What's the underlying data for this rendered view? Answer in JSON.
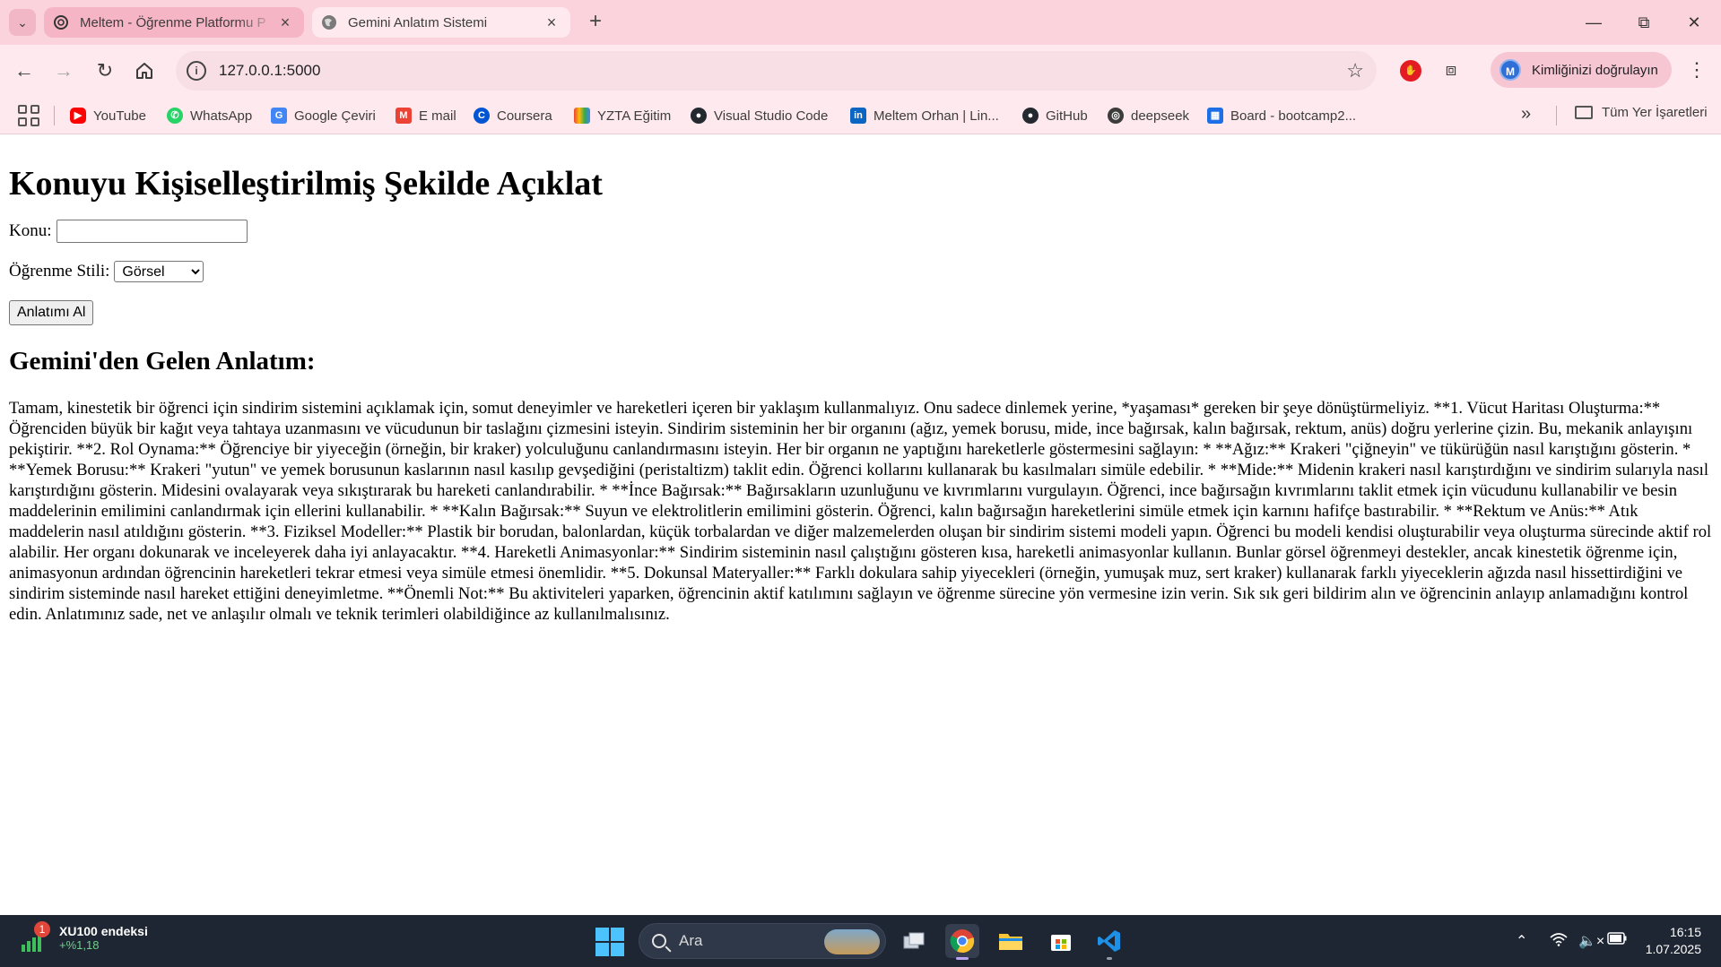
{
  "browser": {
    "tabs": [
      {
        "title": "Meltem - Öğrenme Platformu P",
        "active": false
      },
      {
        "title": "Gemini Anlatım Sistemi",
        "active": true
      }
    ],
    "url": "127.0.0.1:5000",
    "profile_label": "Kimliğinizi doğrulayın",
    "profile_initial": "M",
    "bookmarks": [
      {
        "label": "YouTube",
        "icon": "youtube-icon",
        "color": "#ff0000"
      },
      {
        "label": "WhatsApp",
        "icon": "whatsapp-icon",
        "color": "#25d366"
      },
      {
        "label": "Google Çeviri",
        "icon": "google-translate-icon",
        "color": "#4285f4"
      },
      {
        "label": "E mail",
        "icon": "gmail-icon",
        "color": "#ea4335"
      },
      {
        "label": "Coursera",
        "icon": "coursera-icon",
        "color": "#0056d2"
      },
      {
        "label": "YZTA Eğitim",
        "icon": "yzta-icon",
        "color": "#34a853"
      },
      {
        "label": "Visual Studio Code",
        "icon": "github-icon",
        "color": "#24292f"
      },
      {
        "label": "Meltem Orhan | Lin...",
        "icon": "linkedin-icon",
        "color": "#0a66c2"
      },
      {
        "label": "GitHub",
        "icon": "github-icon",
        "color": "#24292f"
      },
      {
        "label": "deepseek",
        "icon": "globe-icon",
        "color": "#3c3c3c"
      },
      {
        "label": "Board - bootcamp2...",
        "icon": "trello-icon",
        "color": "#1d6fe8"
      }
    ],
    "bookmarks_folder": "Tüm Yer İşaretleri"
  },
  "page": {
    "title": "Konuyu Kişiselleştirilmiş Şekilde Açıklat",
    "topic_label": "Konu:",
    "topic_value": "",
    "style_label": "Öğrenme Stili:",
    "style_selected": "Görsel",
    "submit_label": "Anlatımı Al",
    "result_heading": "Gemini'den Gelen Anlatım:",
    "result_text": "Tamam, kinestetik bir öğrenci için sindirim sistemini açıklamak için, somut deneyimler ve hareketleri içeren bir yaklaşım kullanmalıyız. Onu sadece dinlemek yerine, *yaşaması* gereken bir şeye dönüştürmeliyiz. **1. Vücut Haritası Oluşturma:** Öğrenciden büyük bir kağıt veya tahtaya uzanmasını ve vücudunun bir taslağını çizmesini isteyin. Sindirim sisteminin her bir organını (ağız, yemek borusu, mide, ince bağırsak, kalın bağırsak, rektum, anüs) doğru yerlerine çizin. Bu, mekanik anlayışını pekiştirir. **2. Rol Oynama:** Öğrenciye bir yiyeceğin (örneğin, bir kraker) yolculuğunu canlandırmasını isteyin. Her bir organın ne yaptığını hareketlerle göstermesini sağlayın: * **Ağız:** Krakeri \"çiğneyin\" ve tükürüğün nasıl karıştığını gösterin. * **Yemek Borusu:** Krakeri \"yutun\" ve yemek borusunun kaslarının nasıl kasılıp gevşediğini (peristaltizm) taklit edin. Öğrenci kollarını kullanarak bu kasılmaları simüle edebilir. * **Mide:** Midenin krakeri nasıl karıştırdığını ve sindirim sularıyla nasıl karıştırdığını gösterin. Midesini ovalayarak veya sıkıştırarak bu hareketi canlandırabilir. * **İnce Bağırsak:** Bağırsakların uzunluğunu ve kıvrımlarını vurgulayın. Öğrenci, ince bağırsağın kıvrımlarını taklit etmek için vücudunu kullanabilir ve besin maddelerinin emilimini canlandırmak için ellerini kullanabilir. * **Kalın Bağırsak:** Suyun ve elektrolitlerin emilimini gösterin. Öğrenci, kalın bağırsağın hareketlerini simüle etmek için karnını hafifçe bastırabilir. * **Rektum ve Anüs:** Atık maddelerin nasıl atıldığını gösterin. **3. Fiziksel Modeller:** Plastik bir borudan, balonlardan, küçük torbalardan ve diğer malzemelerden oluşan bir sindirim sistemi modeli yapın. Öğrenci bu modeli kendisi oluşturabilir veya oluşturma sürecinde aktif rol alabilir. Her organı dokunarak ve inceleyerek daha iyi anlayacaktır. **4. Hareketli Animasyonlar:** Sindirim sisteminin nasıl çalıştığını gösteren kısa, hareketli animasyonlar kullanın. Bunlar görsel öğrenmeyi destekler, ancak kinestetik öğrenme için, animasyonun ardından öğrencinin hareketleri tekrar etmesi veya simüle etmesi önemlidir. **5. Dokunsal Materyaller:** Farklı dokulara sahip yiyecekleri (örneğin, yumuşak muz, sert kraker) kullanarak farklı yiyeceklerin ağızda nasıl hissettirdiğini ve sindirim sisteminde nasıl hareket ettiğini deneyimletme. **Önemli Not:** Bu aktiviteleri yaparken, öğrencinin aktif katılımını sağlayın ve öğrenme sürecine yön vermesine izin verin. Sık sık geri bildirim alın ve öğrencinin anlayıp anlamadığını kontrol edin. Anlatımınız sade, net ve anlaşılır olmalı ve teknik terimleri olabildiğince az kullanılmalısınız."
  },
  "taskbar": {
    "widget_name": "XU100 endeksi",
    "widget_change": "+%1,18",
    "widget_badge": "1",
    "search_placeholder": "Ara",
    "time": "16:15",
    "date": "1.07.2025"
  }
}
